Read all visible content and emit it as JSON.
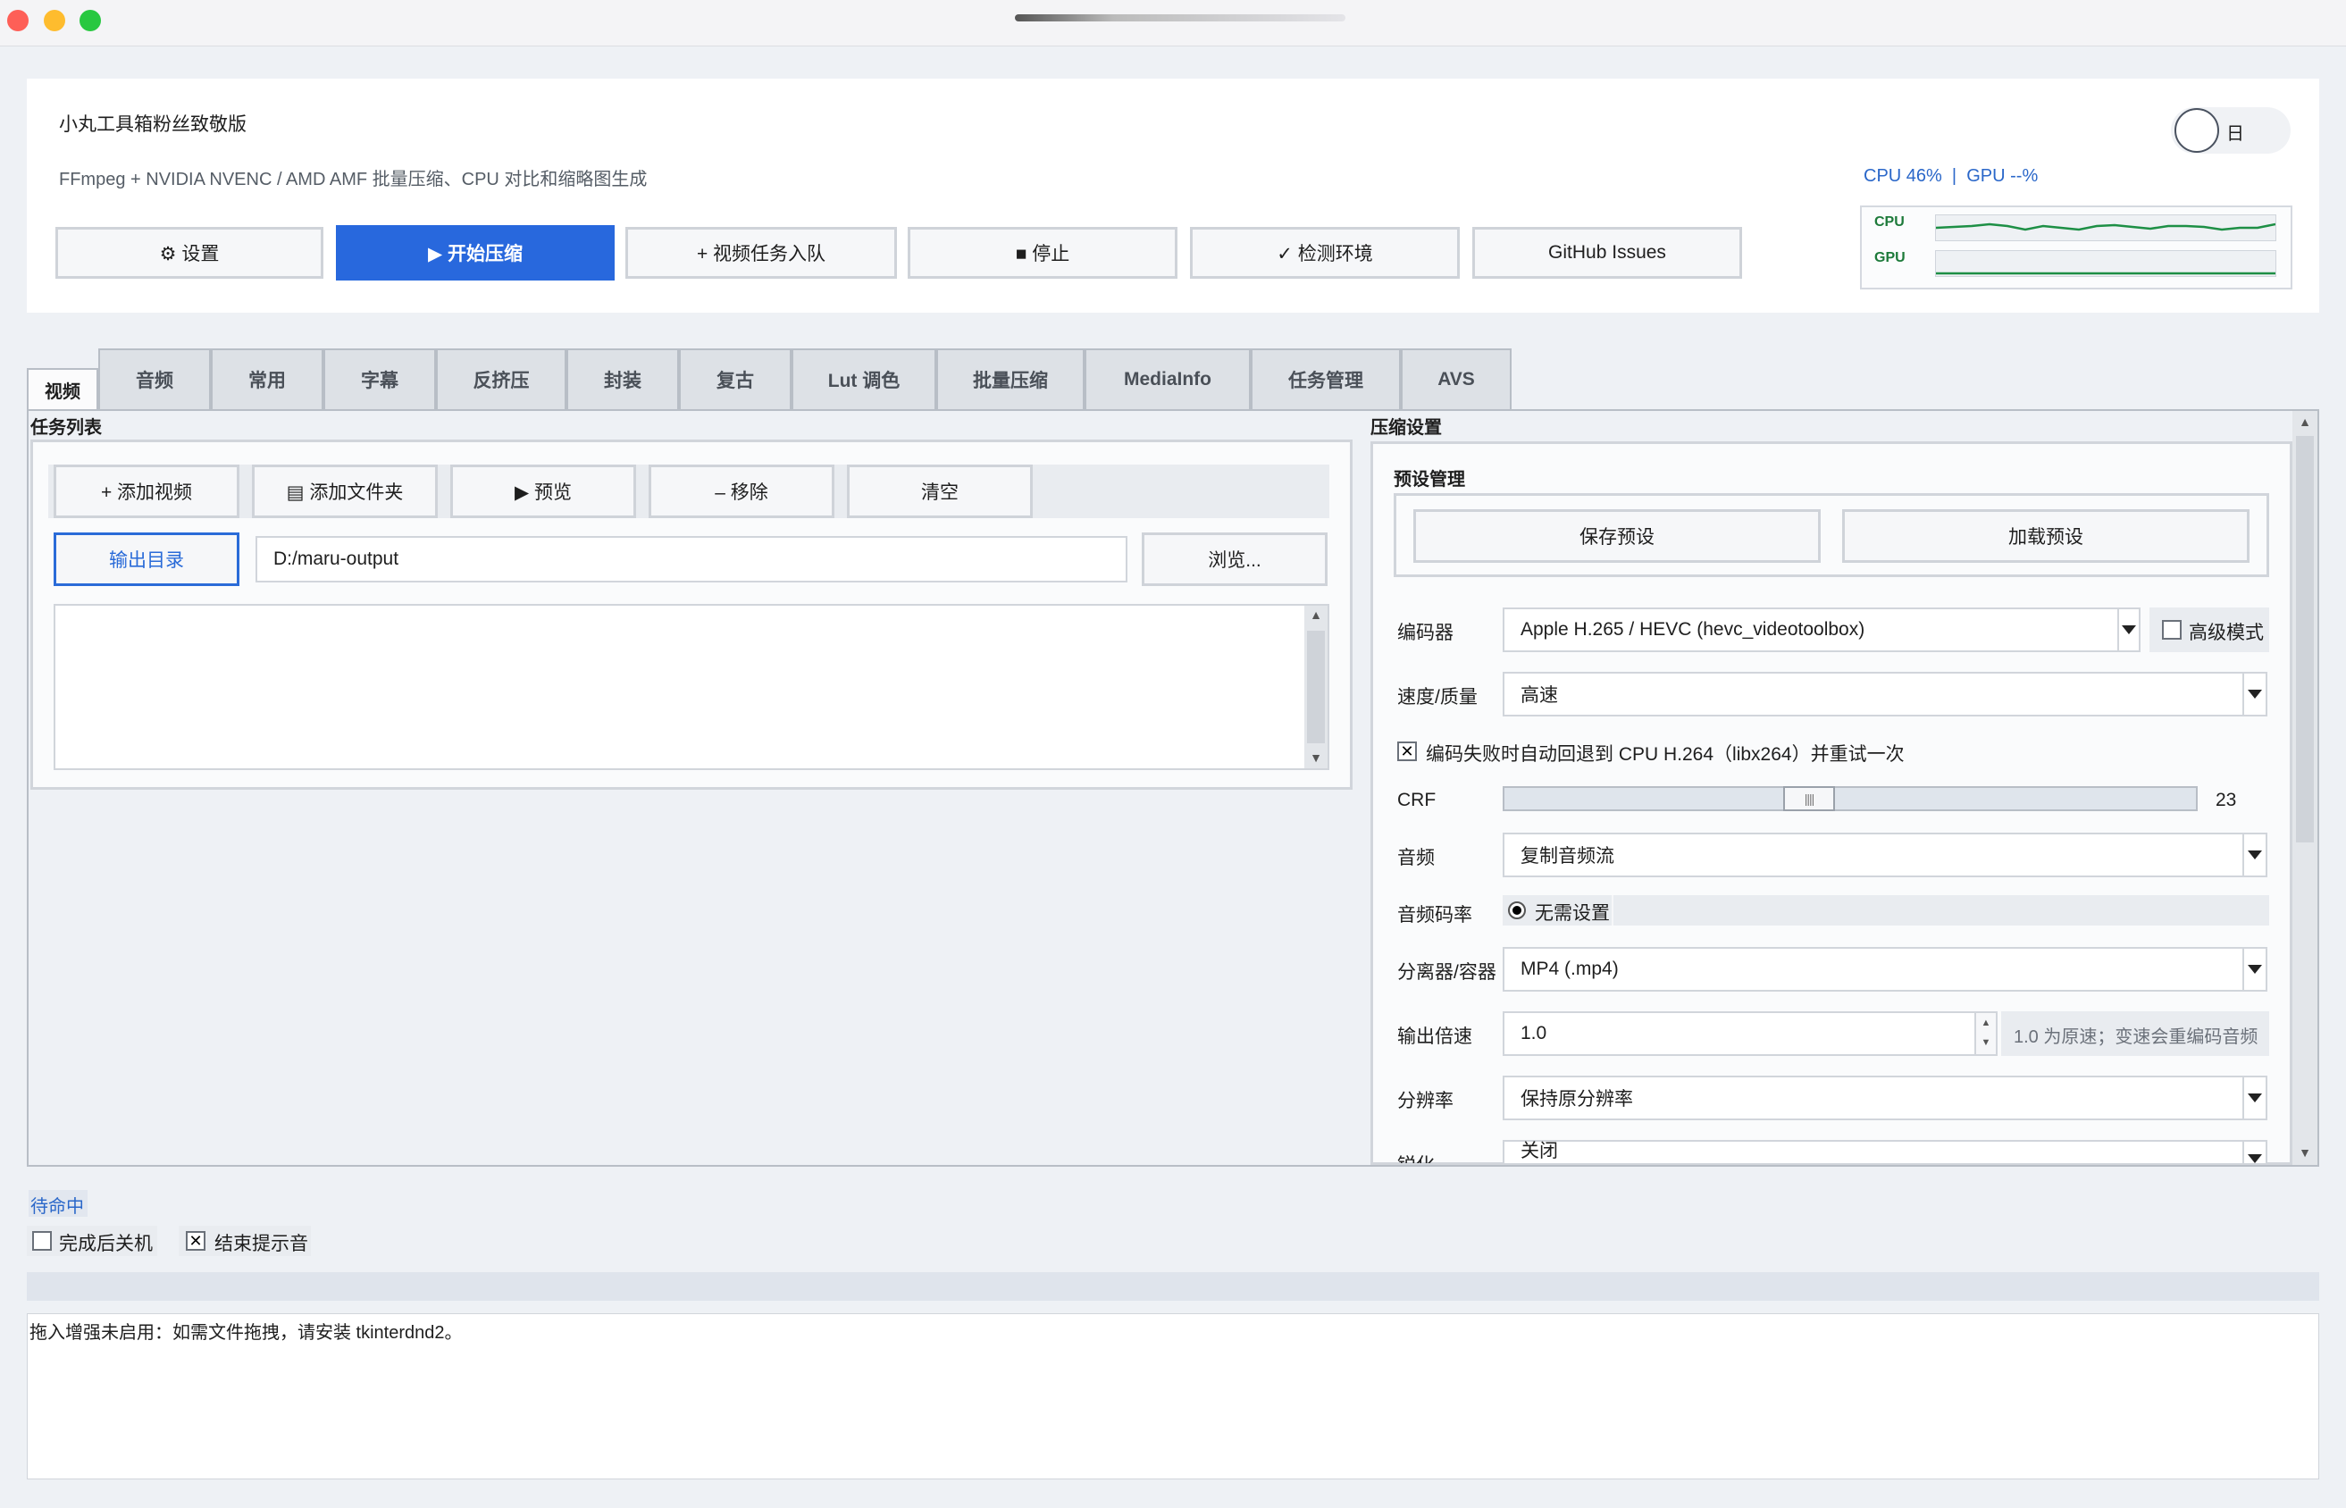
{
  "app": {
    "title": "小丸工具箱粉丝致敬版",
    "subtitle": "FFmpeg + NVIDIA NVENC / AMD AMF 批量压缩、CPU 对比和缩略图生成",
    "theme_label": "日"
  },
  "monitor": {
    "usage_text": "CPU 46%  |  GPU --%",
    "cpu_label": "CPU",
    "gpu_label": "GPU",
    "cpu_percent": 46,
    "cpu_color": "#1d8f45",
    "gpu_color": "#1d8f45"
  },
  "toolbar": {
    "settings": "⚙ 设置",
    "start": "▶ 开始压缩",
    "enqueue": "+ 视频任务入队",
    "stop": "■ 停止",
    "check_env": "✓ 检测环境",
    "github": "GitHub Issues"
  },
  "tabs": [
    "视频",
    "音频",
    "常用",
    "字幕",
    "反挤压",
    "封装",
    "复古",
    "Lut 调色",
    "批量压缩",
    "MediaInfo",
    "任务管理",
    "AVS"
  ],
  "tasks": {
    "section_title": "任务列表",
    "add_video": "+ 添加视频",
    "add_folder": "▤ 添加文件夹",
    "preview": "▶ 预览",
    "remove": "– 移除",
    "clear": "清空",
    "output_dir_button": "输出目录",
    "output_dir_value": "D:/maru-output",
    "browse": "浏览..."
  },
  "compress": {
    "section_title": "压缩设置",
    "preset_title": "预设管理",
    "save_preset": "保存预设",
    "load_preset": "加载预设",
    "encoder_label": "编码器",
    "encoder_value": "Apple H.265 / HEVC (hevc_videotoolbox)",
    "advanced_mode": "高级模式",
    "speed_label": "速度/质量",
    "speed_value": "高速",
    "fallback_text": "编码失败时自动回退到 CPU H.264（libx264）并重试一次",
    "crf_label": "CRF",
    "crf_value": "23",
    "audio_label": "音频",
    "audio_value": "复制音频流",
    "audio_bitrate_label": "音频码率",
    "audio_bitrate_option": "无需设置",
    "container_label": "分离器/容器",
    "container_value": "MP4 (.mp4)",
    "speed_out_label": "输出倍速",
    "speed_out_value": "1.0",
    "speed_out_hint": "1.0 为原速；变速会重编码音频",
    "resolution_label": "分辨率",
    "resolution_value": "保持原分辨率",
    "sharpen_label": "锐化",
    "sharpen_value": "关闭"
  },
  "status": {
    "state": "待命中",
    "shutdown_label": "完成后关机",
    "sound_label": "结束提示音",
    "log_text": "拖入增强未启用：如需文件拖拽，请安装 tkinterdnd2。"
  }
}
